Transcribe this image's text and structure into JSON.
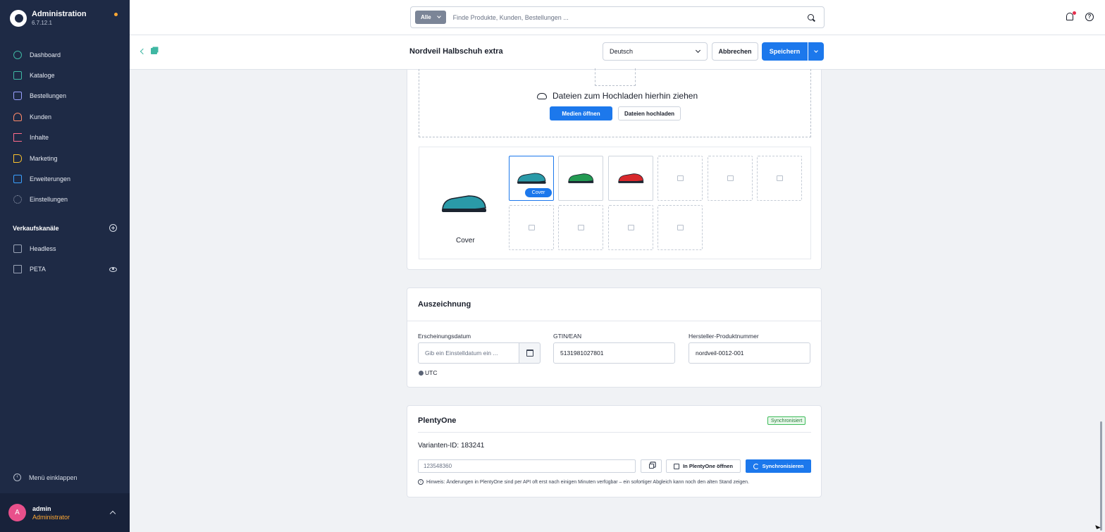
{
  "app": {
    "title": "Administration",
    "version": "6.7.12.1"
  },
  "sidebar": {
    "items": [
      {
        "label": "Dashboard",
        "icon": "dashboard-icon"
      },
      {
        "label": "Kataloge",
        "icon": "catalog-icon"
      },
      {
        "label": "Bestellungen",
        "icon": "orders-icon"
      },
      {
        "label": "Kunden",
        "icon": "customers-icon"
      },
      {
        "label": "Inhalte",
        "icon": "content-icon"
      },
      {
        "label": "Marketing",
        "icon": "megaphone-icon"
      },
      {
        "label": "Erweiterungen",
        "icon": "extensions-icon"
      },
      {
        "label": "Einstellungen",
        "icon": "gear-icon"
      }
    ],
    "sales_channels_title": "Verkaufskanäle",
    "sales_channels": [
      {
        "label": "Headless",
        "icon": "headless-icon"
      },
      {
        "label": "PETA",
        "icon": "storefront-icon"
      }
    ],
    "collapse_label": "Menü einklappen",
    "user": {
      "initial": "A",
      "name": "admin",
      "role": "Administrator"
    }
  },
  "search": {
    "filter": "Alle",
    "placeholder": "Finde Produkte, Kunden, Bestellungen ..."
  },
  "smartbar": {
    "title": "Nordveil Halbschuh extra",
    "language": "Deutsch",
    "cancel_label": "Abbrechen",
    "save_label": "Speichern"
  },
  "media": {
    "dropzone_text": "Dateien zum Hochladen hierhin ziehen",
    "open_media_label": "Medien öffnen",
    "upload_label": "Dateien hochladen",
    "cover_label": "Cover",
    "cover_badge": "Cover",
    "thumbnails": [
      {
        "kind": "shoe",
        "color": "#2a9aa8"
      },
      {
        "kind": "shoe",
        "color": "#239a52"
      },
      {
        "kind": "shoe",
        "color": "#d8282c"
      },
      {
        "kind": "empty"
      },
      {
        "kind": "empty"
      },
      {
        "kind": "empty"
      },
      {
        "kind": "empty"
      },
      {
        "kind": "empty"
      },
      {
        "kind": "empty"
      },
      {
        "kind": "empty"
      }
    ]
  },
  "auszeichnung": {
    "title": "Auszeichnung",
    "release_label": "Erscheinungsdatum",
    "release_placeholder": "Gib ein Einstelldatum ein ...",
    "timezone": "UTC",
    "gtin_label": "GTIN/EAN",
    "gtin_value": "5131981027801",
    "mpn_label": "Hersteller-Produktnummer",
    "mpn_value": "nordveil-0012-001"
  },
  "plentyone": {
    "title": "PlentyOne",
    "status": "Synchronisiert",
    "variant_label": "Varianten-ID: 183241",
    "item_id_value": "123548360",
    "open_label": "In PlentyOne öffnen",
    "sync_label": "Synchronisieren",
    "hint": "Hinweis: Änderungen in PlentyOne sind per API oft erst nach einigen Minuten verfügbar – ein sofortiger Abgleich kann noch den alten Stand zeigen."
  },
  "colors": {
    "accent": "#1c78ec",
    "sidebar": "#1e2a45",
    "brand_teal": "#3fb7a3",
    "status_green": "#3dbb59"
  }
}
